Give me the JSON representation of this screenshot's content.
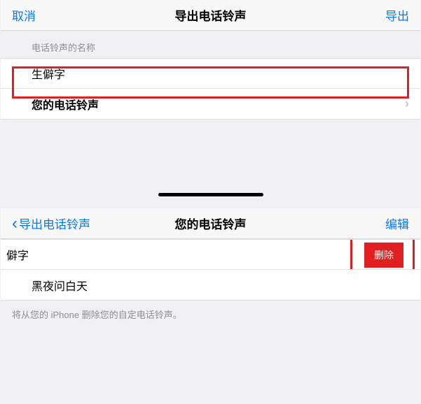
{
  "top": {
    "nav": {
      "left": "取消",
      "title": "导出电话铃声",
      "right": "导出"
    },
    "sectionLabel": "电话铃声的名称",
    "nameRow": "生僻字",
    "selectRow": "您的电话铃声"
  },
  "bottom": {
    "nav": {
      "back": "导出电话铃声",
      "title": "您的电话铃声",
      "right": "编辑"
    },
    "swipedRow": "僻字",
    "deleteLabel": "删除",
    "secondRow": "黑夜问白天",
    "footer": "将从您的 iPhone 删除您的自定电话铃声。"
  }
}
